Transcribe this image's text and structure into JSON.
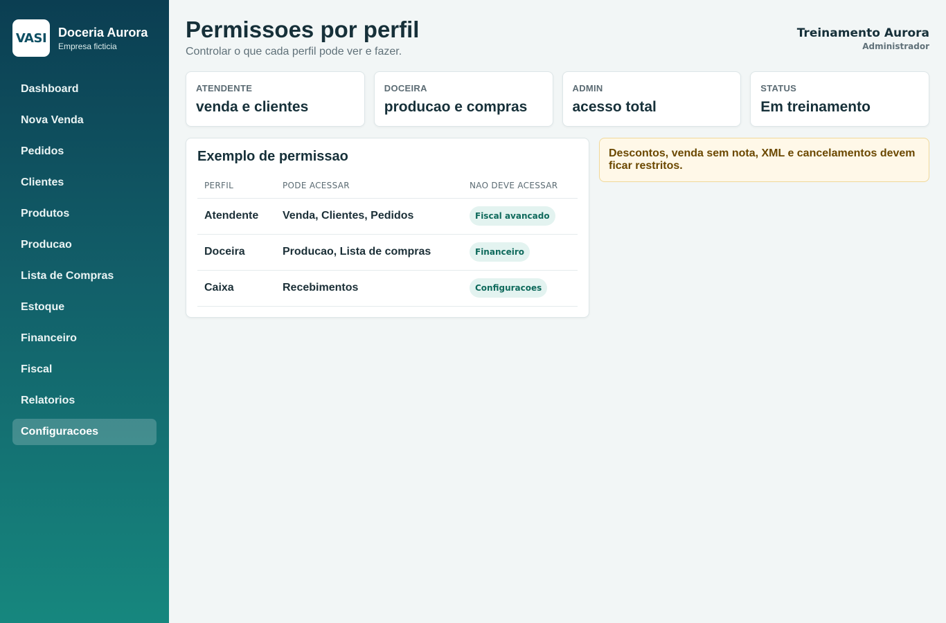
{
  "brand": {
    "logo_text": "VASI",
    "name": "Doceria Aurora",
    "subtitle": "Empresa ficticia"
  },
  "nav": {
    "items": [
      {
        "label": "Dashboard"
      },
      {
        "label": "Nova Venda"
      },
      {
        "label": "Pedidos"
      },
      {
        "label": "Clientes"
      },
      {
        "label": "Produtos"
      },
      {
        "label": "Producao"
      },
      {
        "label": "Lista de Compras"
      },
      {
        "label": "Estoque"
      },
      {
        "label": "Financeiro"
      },
      {
        "label": "Fiscal"
      },
      {
        "label": "Relatorios"
      },
      {
        "label": "Configuracoes",
        "active": true
      }
    ]
  },
  "header": {
    "title": "Permissoes por perfil",
    "subtitle": "Controlar o que cada perfil pode ver e fazer.",
    "user_name": "Treinamento Aurora",
    "user_role": "Administrador"
  },
  "cards": [
    {
      "label": "ATENDENTE",
      "value": "venda e clientes"
    },
    {
      "label": "DOCEIRA",
      "value": "producao e compras"
    },
    {
      "label": "ADMIN",
      "value": "acesso total"
    },
    {
      "label": "STATUS",
      "value": "Em treinamento"
    }
  ],
  "permissions": {
    "title": "Exemplo de permissao",
    "columns": [
      "PERFIL",
      "PODE ACESSAR",
      "NAO DEVE ACESSAR"
    ],
    "rows": [
      {
        "perfil": "Atendente",
        "pode": "Venda, Clientes, Pedidos",
        "nao": "Fiscal avancado"
      },
      {
        "perfil": "Doceira",
        "pode": "Producao, Lista de compras",
        "nao": "Financeiro"
      },
      {
        "perfil": "Caixa",
        "pode": "Recebimentos",
        "nao": "Configuracoes"
      }
    ]
  },
  "alert": {
    "text": "Descontos, venda sem nota, XML e cancelamentos devem ficar restritos."
  },
  "colors": {
    "sidebar_top": "#0b3e52",
    "sidebar_bottom": "#16877e",
    "pill_bg": "#e3f3f0",
    "pill_text": "#0f6a5c",
    "alert_bg": "#fff8e8",
    "alert_text": "#6b4800"
  }
}
